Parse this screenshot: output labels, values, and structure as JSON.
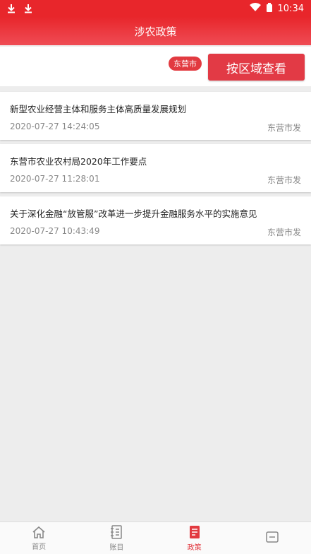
{
  "status": {
    "time": "10:34"
  },
  "header": {
    "title": "涉农政策"
  },
  "filter": {
    "region": "东营市",
    "button_label": "按区域查看"
  },
  "policies": [
    {
      "title": "新型农业经营主体和服务主体高质量发展规划",
      "time": "2020-07-27 14:24:05",
      "source": "东营市发"
    },
    {
      "title": "东营市农业农村局2020年工作要点",
      "time": "2020-07-27 11:28:01",
      "source": "东营市发"
    },
    {
      "title": "关于深化金融“放管服”改革进一步提升金融服务水平的实施意见",
      "time": "2020-07-27 10:43:49",
      "source": "东营市发"
    }
  ],
  "tabs": [
    {
      "label": "首页",
      "icon": "home-icon"
    },
    {
      "label": "账目",
      "icon": "ledger-icon"
    },
    {
      "label": "政策",
      "icon": "policy-book-icon",
      "active": true
    },
    {
      "label": "",
      "icon": "more-icon"
    }
  ],
  "colors": {
    "primary": "#e8262b",
    "accent": "#e23a45"
  }
}
